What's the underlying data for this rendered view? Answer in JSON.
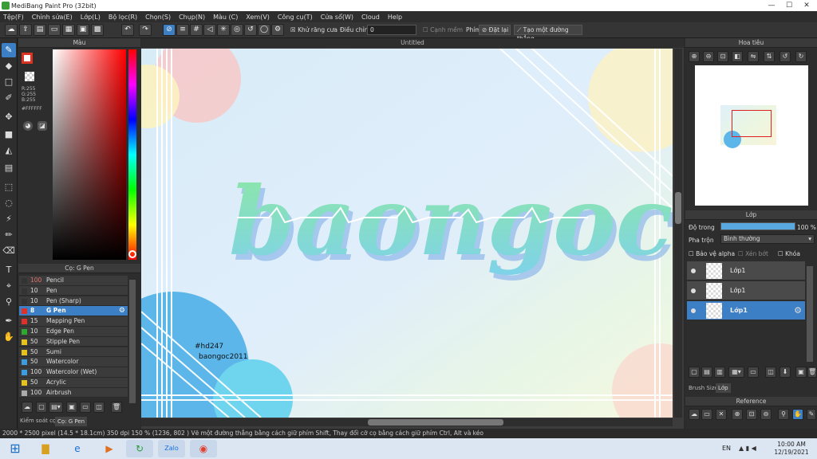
{
  "window": {
    "title": "MediBang Paint Pro (32bit)",
    "min": "—",
    "max": "☐",
    "close": "✕"
  },
  "menu": [
    "Tệp(F)",
    "Chỉnh sửa(E)",
    "Lớp(L)",
    "Bộ lọc(R)",
    "Chọn(S)",
    "Chụp(N)",
    "Màu (C)",
    "Xem(V)",
    "Công cụ(T)",
    "Cửa sổ(W)",
    "Cloud",
    "Help"
  ],
  "toolbar": {
    "antialias": "Khử răng cưa",
    "adjust_label": "Điều chỉnh",
    "adjust_value": "0",
    "canh_mem": "Cạnh mềm",
    "phim": "Phím",
    "reset": "Đặt lại",
    "make_line": "Tạo một đường thẳng"
  },
  "color_panel": {
    "title": "Màu",
    "r": "R:255",
    "g": "G:255",
    "b": "B:255",
    "hex": "#FFFFFF"
  },
  "brush_panel": {
    "title": "Cọ: G Pen",
    "tab1": "Kiểm soát cọ",
    "tab2": "Cọ: G Pen",
    "brushes": [
      {
        "size": "100",
        "name": "Pencil",
        "color": "#333333"
      },
      {
        "size": "10",
        "name": "Pen",
        "color": "#333333"
      },
      {
        "size": "10",
        "name": "Pen (Sharp)",
        "color": "#333333"
      },
      {
        "size": "8",
        "name": "G Pen",
        "color": "#e0302a"
      },
      {
        "size": "15",
        "name": "Mapping Pen",
        "color": "#e0302a"
      },
      {
        "size": "10",
        "name": "Edge Pen",
        "color": "#2ea82e"
      },
      {
        "size": "50",
        "name": "Stipple Pen",
        "color": "#e6c21f"
      },
      {
        "size": "50",
        "name": "Sumi",
        "color": "#e6c21f"
      },
      {
        "size": "50",
        "name": "Watercolor",
        "color": "#3d9be0"
      },
      {
        "size": "100",
        "name": "Watercolor (Wet)",
        "color": "#3d9be0"
      },
      {
        "size": "50",
        "name": "Acrylic",
        "color": "#e6c21f"
      },
      {
        "size": "100",
        "name": "Airbrush",
        "color": "#aaaaaa"
      }
    ]
  },
  "canvas": {
    "tab": "Untitled",
    "artwork_text": "baongoc",
    "credit1": "#hd247",
    "credit2": "baongoc2011"
  },
  "navigator": {
    "title": "Hoa tiêu"
  },
  "layer_panel": {
    "title": "Lớp",
    "opacity_label": "Độ trong",
    "opacity_value": "100 %",
    "opacity_fraction": 1.0,
    "blend_label": "Pha trộn",
    "blend_value": "Bình thường",
    "alpha_protect": "Bảo vệ alpha",
    "clipping": "Xén bớt",
    "lock": "Khóa",
    "layers": [
      {
        "name": "Lớp1"
      },
      {
        "name": "Lớp1"
      },
      {
        "name": "Lớp1"
      }
    ],
    "tab1": "Brush Size",
    "tab2": "Lớp"
  },
  "reference": {
    "title": "Reference"
  },
  "status": "2000 * 2500 pixel   (14.5 * 18.1cm)   350 dpi   150 %   (1236, 802 )   Vẽ một đường thẳng bằng cách giữ phím Shift, Thay đổi cỡ cọ bằng cách giữ phím Ctrl, Alt và kéo",
  "taskbar": {
    "lang": "EN",
    "time": "10:00 AM",
    "date": "12/19/2021",
    "zalo": "Zalo"
  }
}
